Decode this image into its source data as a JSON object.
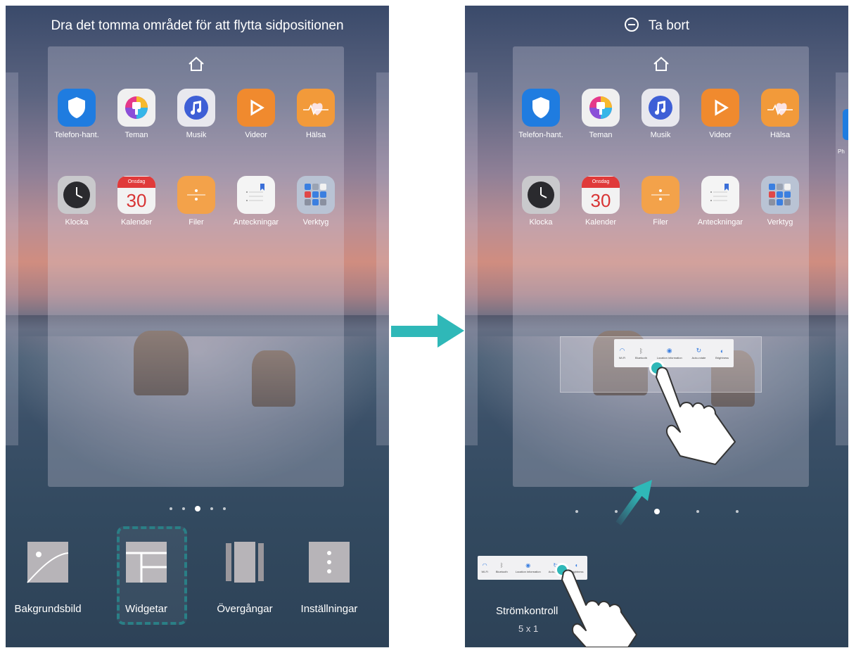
{
  "left": {
    "top_instruction": "Dra det tomma området för att flytta sidpositionen",
    "apps_row1": [
      {
        "label": "Telefon-hant.",
        "icon": "phone-manager-icon",
        "color": "#1f7ce0"
      },
      {
        "label": "Teman",
        "icon": "themes-icon",
        "color": "#f0f0f0"
      },
      {
        "label": "Musik",
        "icon": "music-icon",
        "color": "#e8e8ee"
      },
      {
        "label": "Videor",
        "icon": "video-icon",
        "color": "#f08a2e"
      },
      {
        "label": "Hälsa",
        "icon": "health-icon",
        "color": "#f29a3a"
      }
    ],
    "apps_row2": [
      {
        "label": "Klocka",
        "icon": "clock-icon",
        "color": "#c9c9cc"
      },
      {
        "label": "Kalender",
        "icon": "calendar-icon",
        "color": "#f2f2f2"
      },
      {
        "label": "Filer",
        "icon": "files-icon",
        "color": "#f3a24a"
      },
      {
        "label": "Anteckningar",
        "icon": "notes-icon",
        "color": "#f4f4f4"
      },
      {
        "label": "Verktyg",
        "icon": "tools-folder-icon",
        "color": "#b9c3d4"
      }
    ],
    "calendar": {
      "day_name": "Onsdag",
      "day_number": "30"
    },
    "tools": [
      {
        "label": "Bakgrundsbild",
        "icon": "wallpaper-icon"
      },
      {
        "label": "Widgetar",
        "icon": "widgets-icon"
      },
      {
        "label": "Övergångar",
        "icon": "transitions-icon"
      },
      {
        "label": "Inställningar",
        "icon": "settings-icon"
      }
    ]
  },
  "right": {
    "remove_label": "Ta bort",
    "side_label": "Ph",
    "widget_items": [
      {
        "label": "Wi-Fi",
        "icon": "wifi-icon"
      },
      {
        "label": "Bluetooth",
        "icon": "bluetooth-icon"
      },
      {
        "label": "Location information",
        "icon": "location-icon"
      },
      {
        "label": "Auto-rotate",
        "icon": "rotate-icon"
      },
      {
        "label": "Brightness",
        "icon": "brightness-icon"
      }
    ],
    "widget_name": "Strömkontroll",
    "widget_size": "5 x 1"
  },
  "colors": {
    "accent": "#2fb8b8",
    "highlight_border": "#2a7f86"
  }
}
